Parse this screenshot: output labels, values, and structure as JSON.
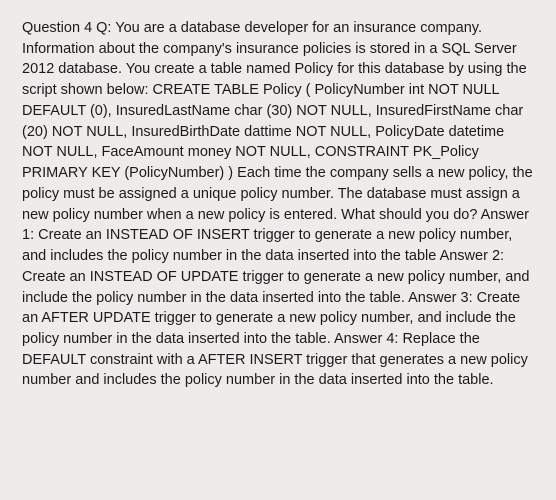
{
  "question": {
    "label": "Question 4 Q:",
    "body": "You are a database developer for an insurance company. Information about the company's insurance policies is stored in a SQL Server 2012 database. You create a table named Policy for this database by using the script shown below: CREATE TABLE Policy ( PolicyNumber int NOT NULL DEFAULT (0), InsuredLastName char (30) NOT NULL, InsuredFirstName char (20) NOT NULL, InsuredBirthDate dattime NOT NULL, PolicyDate datetime NOT NULL, FaceAmount money NOT NULL, CONSTRAINT PK_Policy PRIMARY KEY (PolicyNumber) ) Each time the company sells a new policy, the policy must be assigned a unique policy number. The database must assign a new policy number when a new policy is entered. What should you do?"
  },
  "answers": [
    {
      "label": "Answer 1:",
      "text": "Create an INSTEAD OF INSERT trigger to generate a new policy number, and includes the policy number in the data inserted into the table"
    },
    {
      "label": "Answer 2:",
      "text": "Create an INSTEAD OF UPDATE trigger to generate a new policy number, and include the policy number in the data inserted into the table."
    },
    {
      "label": "Answer 3:",
      "text": "Create an AFTER UPDATE trigger to generate a new policy number, and include the policy number in the data inserted into the table."
    },
    {
      "label": "Answer 4:",
      "text": "Replace the DEFAULT constraint with a AFTER INSERT trigger that generates a new policy number and includes the policy number in the data inserted into the table."
    }
  ]
}
